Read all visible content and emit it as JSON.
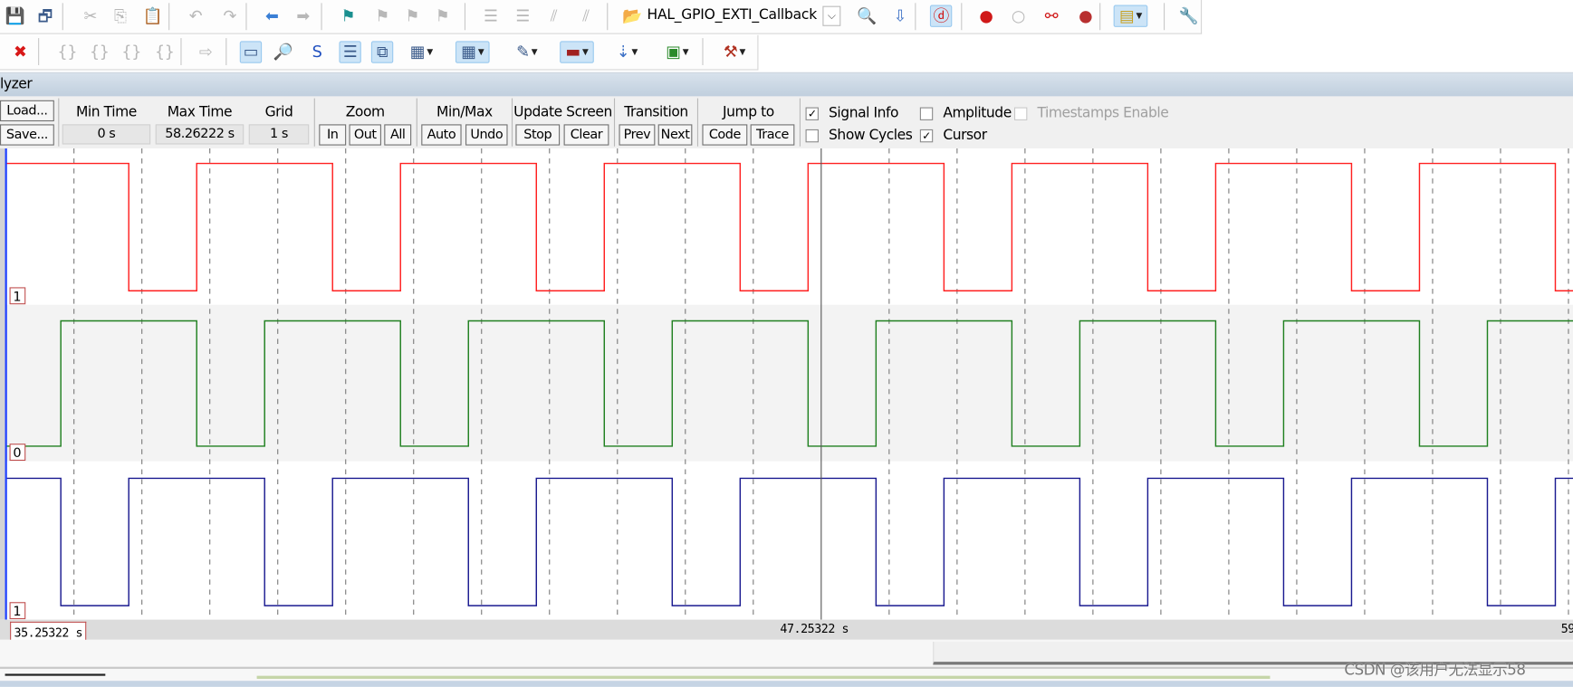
{
  "toolbar1": {
    "icons": [
      {
        "name": "save-icon",
        "glyph": "💾",
        "x": 0
      },
      {
        "name": "save-all-icon",
        "glyph": "🗗",
        "x": 30
      },
      {
        "name": "cut-icon",
        "glyph": "✂",
        "x": 75,
        "disabled": true
      },
      {
        "name": "copy-icon",
        "glyph": "⎘",
        "x": 105,
        "disabled": true
      },
      {
        "name": "paste-icon",
        "glyph": "📋",
        "x": 137
      },
      {
        "name": "undo-icon",
        "glyph": "↶",
        "x": 180,
        "disabled": true
      },
      {
        "name": "redo-icon",
        "glyph": "↷",
        "x": 214,
        "disabled": true
      },
      {
        "name": "navigate-back-icon",
        "glyph": "⬅",
        "x": 256,
        "color": "#3a7fd5"
      },
      {
        "name": "navigate-forward-icon",
        "glyph": "➡",
        "x": 287,
        "disabled": true
      },
      {
        "name": "bookmark-icon",
        "glyph": "⚑",
        "x": 332,
        "color": "#1a8f8f"
      },
      {
        "name": "prev-bookmark-icon",
        "glyph": "⚑",
        "x": 366,
        "disabled": true
      },
      {
        "name": "next-bookmark-icon",
        "glyph": "⚑",
        "x": 396,
        "disabled": true
      },
      {
        "name": "clear-bookmarks-icon",
        "glyph": "⚑",
        "x": 426,
        "disabled": true
      },
      {
        "name": "indent-icon",
        "glyph": "☰",
        "x": 474,
        "disabled": true
      },
      {
        "name": "unindent-icon",
        "glyph": "☰",
        "x": 506,
        "disabled": true
      },
      {
        "name": "comment-icon",
        "glyph": "⫽",
        "x": 537,
        "disabled": true
      },
      {
        "name": "uncomment-icon",
        "glyph": "⫽",
        "x": 569,
        "disabled": true
      },
      {
        "name": "find-in-files-icon",
        "glyph": "📂",
        "x": 615
      },
      {
        "name": "find-icon",
        "glyph": "🔍",
        "x": 849
      },
      {
        "name": "incremental-find-icon",
        "glyph": "⇩",
        "x": 882,
        "color": "#3a6fc5"
      },
      {
        "name": "debug-session-icon",
        "glyph": "ⓓ",
        "x": 923,
        "hl": true,
        "color": "#d01010"
      },
      {
        "name": "insert-breakpoint-icon",
        "glyph": "●",
        "x": 968,
        "color": "#d01818"
      },
      {
        "name": "enable-breakpoint-icon",
        "glyph": "○",
        "x": 1000,
        "disabled": true
      },
      {
        "name": "disable-breakpoints-icon",
        "glyph": "⚯",
        "x": 1033,
        "color": "#d01818"
      },
      {
        "name": "kill-breakpoints-icon",
        "glyph": "●",
        "x": 1067,
        "color": "#b83030"
      },
      {
        "name": "window-layout-icon",
        "glyph": "▤",
        "x": 1106,
        "hl": true,
        "drop": true,
        "color": "#c8a020"
      },
      {
        "name": "configure-icon",
        "glyph": "🔧",
        "x": 1170,
        "color": "#4a70a8"
      }
    ],
    "seps": [
      62,
      168,
      245,
      320,
      463,
      605,
      912,
      958,
      1096,
      1160
    ],
    "function_combo": "HAL_GPIO_EXTI_Callback"
  },
  "toolbar2": {
    "icons": [
      {
        "name": "stop-debug-icon",
        "glyph": "✖",
        "x": 5,
        "color": "#d81818"
      },
      {
        "name": "step-into-icon",
        "glyph": "{}",
        "x": 52,
        "disabled": true
      },
      {
        "name": "step-over-icon",
        "glyph": "{}",
        "x": 84,
        "disabled": true
      },
      {
        "name": "step-out-icon",
        "glyph": "{}",
        "x": 116,
        "disabled": true
      },
      {
        "name": "run-to-cursor-icon",
        "glyph": "{}",
        "x": 149,
        "disabled": true
      },
      {
        "name": "show-next-statement-icon",
        "glyph": "⇨",
        "x": 190,
        "disabled": true
      },
      {
        "name": "command-window-icon",
        "glyph": "▭",
        "x": 235,
        "hl": true
      },
      {
        "name": "disassembly-window-icon",
        "glyph": "🔎",
        "x": 267
      },
      {
        "name": "symbols-window-icon",
        "glyph": "S",
        "x": 301,
        "color": "#2050c0"
      },
      {
        "name": "registers-window-icon",
        "glyph": "☰",
        "x": 334,
        "hl": true
      },
      {
        "name": "call-stack-window-icon",
        "glyph": "⧉",
        "x": 366,
        "hl": true
      },
      {
        "name": "watch-windows-icon",
        "glyph": "▦",
        "x": 399,
        "drop": true
      },
      {
        "name": "memory-windows-icon",
        "glyph": "▦",
        "x": 450,
        "hl": true,
        "drop": true
      },
      {
        "name": "serial-windows-icon",
        "glyph": "✎",
        "x": 504,
        "drop": true
      },
      {
        "name": "analysis-windows-icon",
        "glyph": "▬",
        "x": 554,
        "hl": true,
        "drop": true,
        "color": "#a02020"
      },
      {
        "name": "trace-windows-icon",
        "glyph": "⇣",
        "x": 604,
        "drop": true,
        "color": "#3a6fc5"
      },
      {
        "name": "system-viewer-icon",
        "glyph": "▣",
        "x": 654,
        "drop": true,
        "color": "#2a8a2a"
      },
      {
        "name": "toolbox-icon",
        "glyph": "⚒",
        "x": 711,
        "drop": true,
        "color": "#b03020"
      }
    ],
    "seps": [
      38,
      180,
      225,
      700
    ]
  },
  "panel_title": "lyzer",
  "controls": {
    "load": "Load...",
    "save": "Save...",
    "min_time_label": "Min Time",
    "min_time": "0 s",
    "max_time_label": "Max Time",
    "max_time": "58.26222 s",
    "grid_label": "Grid",
    "grid": "1 s",
    "zoom_label": "Zoom",
    "zoom_in": "In",
    "zoom_out": "Out",
    "zoom_all": "All",
    "minmax_label": "Min/Max",
    "auto": "Auto",
    "undo": "Undo",
    "update_label": "Update Screen",
    "stop": "Stop",
    "clear": "Clear",
    "transition_label": "Transition",
    "prev": "Prev",
    "next": "Next",
    "jump_label": "Jump to",
    "code": "Code",
    "trace": "Trace",
    "signal_info": {
      "label": "Signal Info",
      "checked": true
    },
    "amplitude": {
      "label": "Amplitude",
      "checked": false
    },
    "timestamps": {
      "label": "Timestamps Enable",
      "checked": false,
      "disabled": true
    },
    "show_cycles": {
      "label": "Show Cycles",
      "checked": false
    },
    "cursor": {
      "label": "Cursor",
      "checked": true
    }
  },
  "chart_data": {
    "type": "line",
    "step": true,
    "xlim": [
      35.25322,
      58.32
    ],
    "grid_interval_s": 1,
    "grid": true,
    "cursor_time": 47.25322,
    "series": [
      {
        "color": "#ff2020",
        "initial": 1,
        "transitions": [
          37.06,
          38.06,
          40.06,
          41.06,
          43.06,
          44.06,
          46.06,
          47.06,
          49.06,
          50.06,
          52.06,
          53.06,
          55.06,
          56.06,
          58.06
        ],
        "value_at_left": "1"
      },
      {
        "color": "#208020",
        "initial": 0,
        "transitions": [
          36.06,
          38.06,
          39.06,
          41.06,
          42.06,
          44.06,
          45.06,
          47.06,
          48.06,
          50.06,
          51.06,
          53.06,
          54.06,
          56.06,
          57.06
        ],
        "value_at_left": "0"
      },
      {
        "color": "#1a1a90",
        "initial": 1,
        "transitions": [
          36.06,
          37.06,
          39.06,
          40.06,
          42.06,
          43.06,
          45.06,
          46.06,
          48.06,
          49.06,
          51.06,
          52.06,
          54.06,
          55.06,
          57.06,
          58.06
        ],
        "value_at_left": "1"
      }
    ],
    "tick_labels": {
      "left": "35.25322 s",
      "cursor": "47.25322 s",
      "right": "59"
    }
  },
  "watermark": "CSDN @该用户无法显示58"
}
